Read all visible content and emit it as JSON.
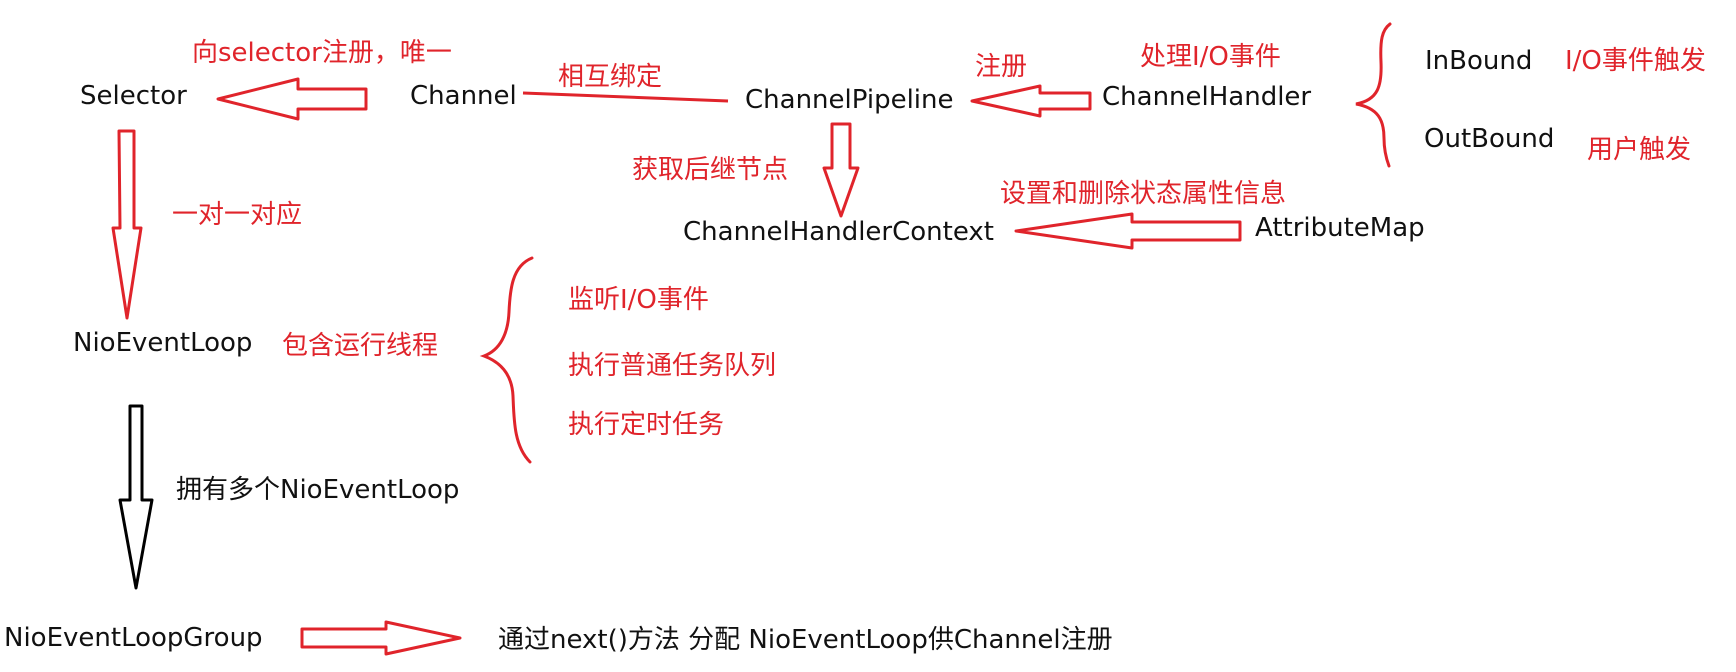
{
  "nodes": {
    "selector": "Selector",
    "channel": "Channel",
    "channel_pipeline": "ChannelPipeline",
    "channel_handler": "ChannelHandler",
    "inbound": "InBound",
    "outbound": "OutBound",
    "channel_handler_context": "ChannelHandlerContext",
    "attribute_map": "AttributeMap",
    "nio_event_loop": "NioEventLoop",
    "nio_event_loop_group": "NioEventLoopGroup"
  },
  "annotations": {
    "register_selector_unique": "向selector注册，唯一",
    "mutual_binding": "相互绑定",
    "register": "注册",
    "handle_io_events": "处理I/O事件",
    "inbound_desc": "I/O事件触发",
    "outbound_desc": "用户触发",
    "get_successor_node": "获取后继节点",
    "set_delete_attributes": "设置和删除状态属性信息",
    "one_to_one": "一对一对应",
    "contains_thread": "包含运行线程",
    "listen_io_events": "监听I/O事件",
    "execute_normal_tasks": "执行普通任务队列",
    "execute_scheduled_tasks": "执行定时任务",
    "has_multiple_loops": "拥有多个NioEventLoop",
    "next_method_assign": "通过next()方法 分配 NioEventLoop供Channel注册"
  },
  "colors": {
    "annotation": "#e0242b",
    "node_text": "#111111",
    "black_arrow": "#000000"
  }
}
